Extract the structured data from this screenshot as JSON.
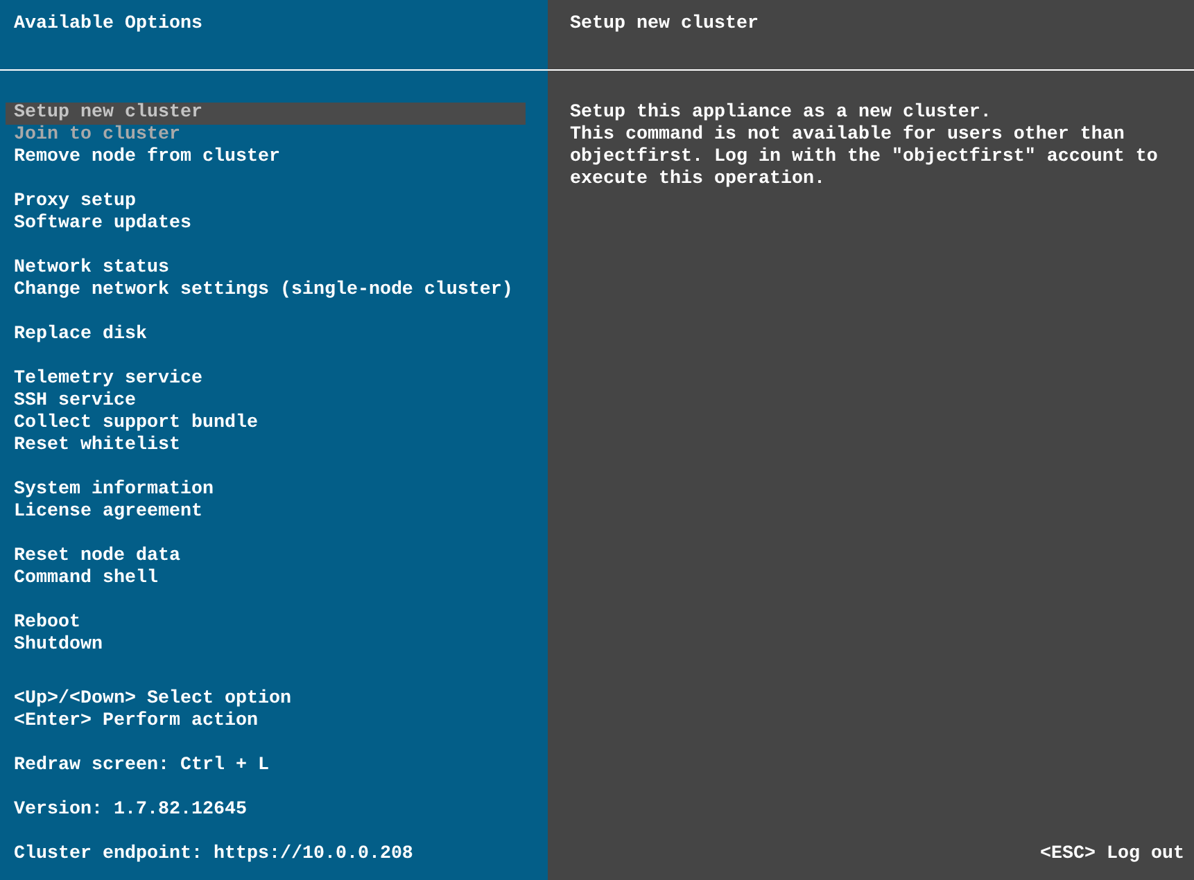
{
  "options_panel": {
    "title": "Available Options",
    "menu_groups": [
      {
        "items": [
          {
            "label": "Setup new cluster",
            "selected": true,
            "disabled": false
          },
          {
            "label": "Join to cluster",
            "selected": false,
            "disabled": true
          },
          {
            "label": "Remove node from cluster",
            "selected": false,
            "disabled": false
          }
        ]
      },
      {
        "items": [
          {
            "label": "Proxy setup",
            "selected": false,
            "disabled": false
          },
          {
            "label": "Software updates",
            "selected": false,
            "disabled": false
          }
        ]
      },
      {
        "items": [
          {
            "label": "Network status",
            "selected": false,
            "disabled": false
          },
          {
            "label": "Change network settings (single-node cluster)",
            "selected": false,
            "disabled": false
          }
        ]
      },
      {
        "items": [
          {
            "label": "Replace disk",
            "selected": false,
            "disabled": false
          }
        ]
      },
      {
        "items": [
          {
            "label": "Telemetry service",
            "selected": false,
            "disabled": false
          },
          {
            "label": "SSH service",
            "selected": false,
            "disabled": false
          },
          {
            "label": "Collect support bundle",
            "selected": false,
            "disabled": false
          },
          {
            "label": "Reset whitelist",
            "selected": false,
            "disabled": false
          }
        ]
      },
      {
        "items": [
          {
            "label": "System information",
            "selected": false,
            "disabled": false
          },
          {
            "label": "License agreement",
            "selected": false,
            "disabled": false
          }
        ]
      },
      {
        "items": [
          {
            "label": "Reset node data",
            "selected": false,
            "disabled": false
          },
          {
            "label": "Command shell",
            "selected": false,
            "disabled": false
          }
        ]
      },
      {
        "items": [
          {
            "label": "Reboot",
            "selected": false,
            "disabled": false
          },
          {
            "label": "Shutdown",
            "selected": false,
            "disabled": false
          }
        ]
      }
    ],
    "footer_groups": [
      {
        "lines": [
          "<Up>/<Down> Select option",
          "<Enter> Perform action"
        ]
      },
      {
        "lines": [
          "Redraw screen: Ctrl + L"
        ]
      },
      {
        "lines": [
          "Version: 1.7.82.12645"
        ]
      },
      {
        "lines": [
          "Cluster endpoint: https://10.0.0.208"
        ]
      }
    ]
  },
  "details_panel": {
    "title": "Setup new cluster",
    "description": [
      "Setup this appliance as a new cluster.",
      "This command is not available for users other than objectfirst. Log in with the \"objectfirst\" account to execute this operation."
    ],
    "exit_hint": "<ESC> Log out"
  }
}
